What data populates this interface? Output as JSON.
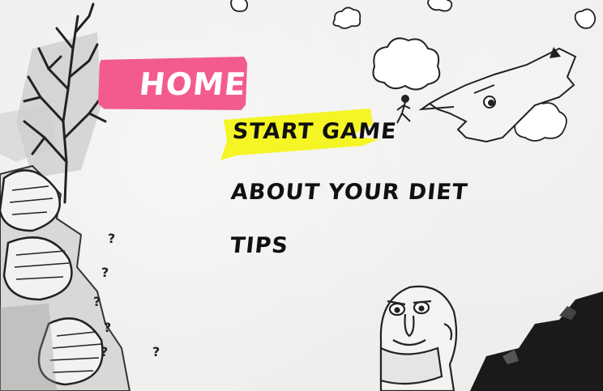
{
  "menu": {
    "title": "HOME",
    "items": [
      {
        "label": "START GAME",
        "selected": true
      },
      {
        "label": "ABOUT YOUR DIET",
        "selected": false
      },
      {
        "label": "TIPS",
        "selected": false
      }
    ]
  },
  "decor": {
    "question_marks": [
      "?",
      "?",
      "?",
      "?",
      "?",
      "?"
    ]
  },
  "colors": {
    "title_banner": "#f35b8e",
    "selected_highlight": "#f5f525",
    "paper": "#ededeb",
    "ink": "#111111"
  }
}
